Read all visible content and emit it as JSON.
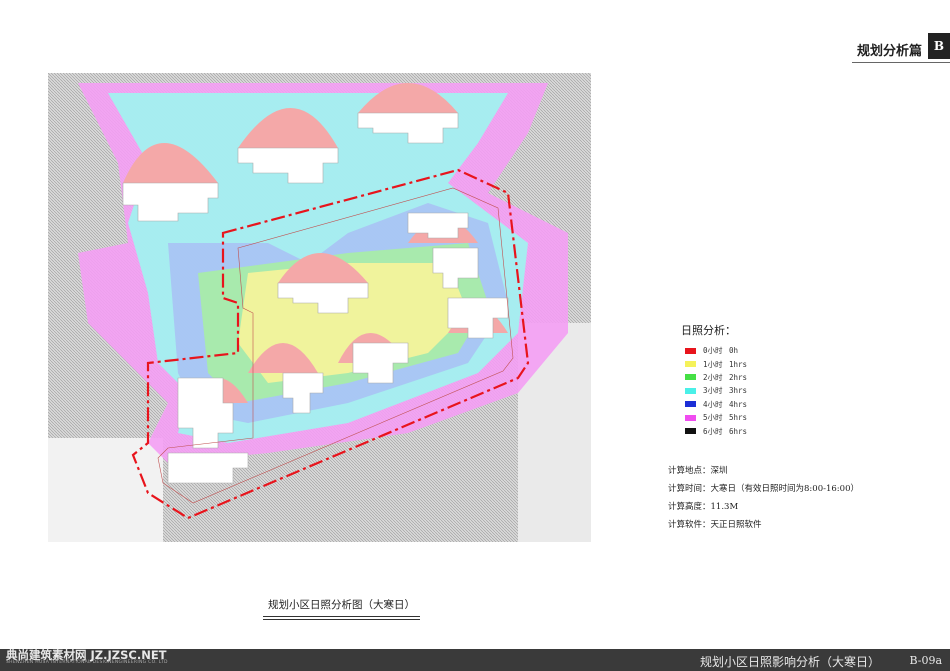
{
  "header": {
    "title": "规划分析篇",
    "badge": "B"
  },
  "legend": {
    "title": "日照分析：",
    "items": [
      {
        "zh": "0小时",
        "en": "0h",
        "color": "#e8141c"
      },
      {
        "zh": "1小时",
        "en": "1hrs",
        "color": "#f5f25a"
      },
      {
        "zh": "2小时",
        "en": "2hrs",
        "color": "#45e045"
      },
      {
        "zh": "3小时",
        "en": "3hrs",
        "color": "#4af0e8"
      },
      {
        "zh": "4小时",
        "en": "4hrs",
        "color": "#1c2fd6"
      },
      {
        "zh": "5小时",
        "en": "5hrs",
        "color": "#f04cf0"
      },
      {
        "zh": "6小时",
        "en": "6hrs",
        "color": "#111111"
      }
    ]
  },
  "info": {
    "location": {
      "label": "计算地点：",
      "value": "深圳"
    },
    "time": {
      "label": "计算时间：",
      "value": "大寒日（有效日照时间为8:00-16:00）"
    },
    "height": {
      "label": "计算高度：",
      "value": "11.3M"
    },
    "software": {
      "label": "计算软件：",
      "value": "天正日照软件"
    }
  },
  "caption": "规划小区日照分析图（大寒日）",
  "footer": {
    "logo": "典尚建筑素材网 JZ.JZSC.NET",
    "subtitle": "SHENZHEN HUSA INTERNATIONAL DESIGNENGINEERING CO. LTD",
    "title": "规划小区日照影响分析（大寒日）",
    "page": "B-09a"
  }
}
